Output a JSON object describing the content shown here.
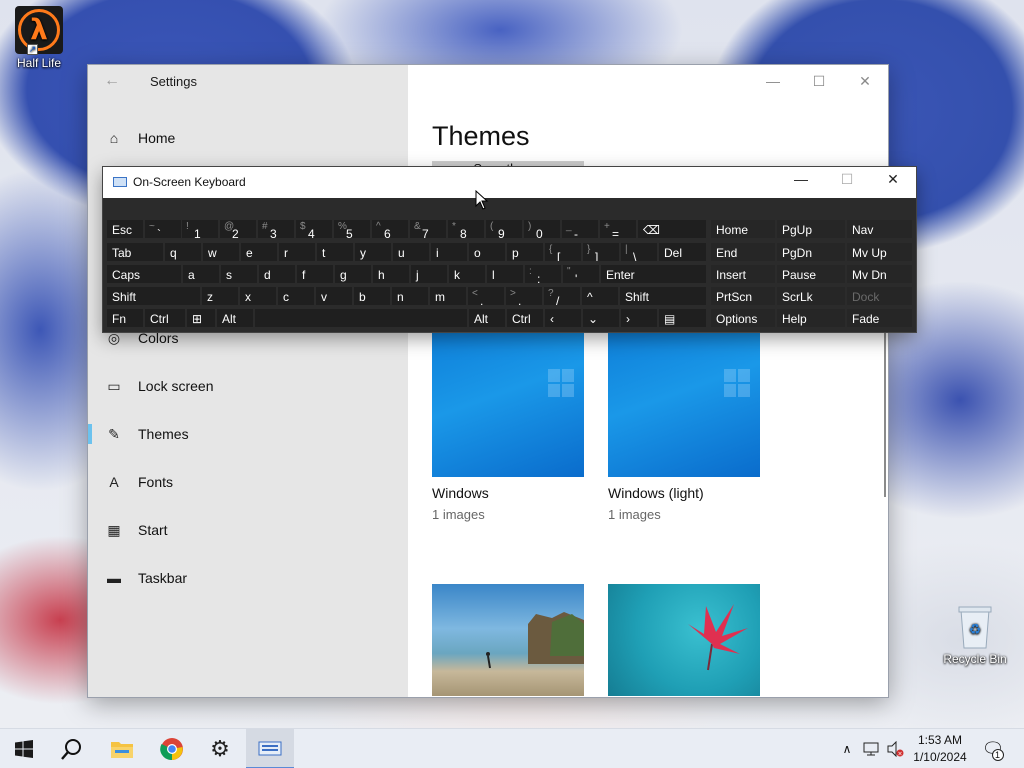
{
  "desktop": {
    "icons": [
      {
        "label": "Half Life",
        "icon": "half-life-icon"
      },
      {
        "label": "Recycle Bin",
        "icon": "recycle-bin-icon"
      }
    ]
  },
  "settings": {
    "title": "Settings",
    "page_title": "Themes",
    "save_theme_label": "Save theme",
    "nav": {
      "home": "Home",
      "colors": "Colors",
      "lock_screen": "Lock screen",
      "themes": "Themes",
      "fonts": "Fonts",
      "start": "Start",
      "taskbar": "Taskbar"
    },
    "themes": [
      {
        "name": "Windows",
        "count": "1 images"
      },
      {
        "name": "Windows (light)",
        "count": "1 images"
      }
    ]
  },
  "osk": {
    "title": "On-Screen Keyboard",
    "row1": [
      {
        "main": "Esc"
      },
      {
        "shift": "~",
        "main": "`"
      },
      {
        "shift": "!",
        "main": "1"
      },
      {
        "shift": "@",
        "main": "2"
      },
      {
        "shift": "#",
        "main": "3"
      },
      {
        "shift": "$",
        "main": "4"
      },
      {
        "shift": "%",
        "main": "5"
      },
      {
        "shift": "^",
        "main": "6"
      },
      {
        "shift": "&",
        "main": "7"
      },
      {
        "shift": "*",
        "main": "8"
      },
      {
        "shift": "(",
        "main": "9"
      },
      {
        "shift": ")",
        "main": "0"
      },
      {
        "shift": "_",
        "main": "-"
      },
      {
        "shift": "+",
        "main": "="
      },
      {
        "main": "⌫"
      }
    ],
    "row2": [
      "Tab",
      "q",
      "w",
      "e",
      "r",
      "t",
      "y",
      "u",
      "i",
      "o",
      "p",
      "[",
      "]",
      "\\",
      "Del"
    ],
    "row2_shift": {
      "lbrace": "{",
      "rbrace": "}",
      "pipe": "|"
    },
    "row3": [
      "Caps",
      "a",
      "s",
      "d",
      "f",
      "g",
      "h",
      "j",
      "k",
      "l",
      ";",
      "'",
      "Enter"
    ],
    "row3_shift": {
      "colon": ":",
      "quote": "\""
    },
    "row4": [
      "Shift",
      "z",
      "x",
      "c",
      "v",
      "b",
      "n",
      "m",
      ",",
      ".",
      "/",
      "^",
      "Shift"
    ],
    "row4_shift": {
      "lt": "<",
      "gt": ">",
      "q": "?"
    },
    "row5": [
      "Fn",
      "Ctrl",
      "Alt",
      "Alt",
      "Ctrl"
    ],
    "nav_keys": [
      [
        "Home",
        "PgUp",
        "Nav"
      ],
      [
        "End",
        "PgDn",
        "Mv Up"
      ],
      [
        "Insert",
        "Pause",
        "Mv Dn"
      ],
      [
        "PrtScn",
        "ScrLk",
        "Dock"
      ],
      [
        "Options",
        "Help",
        "Fade"
      ]
    ]
  },
  "taskbar": {
    "time": "1:53 AM",
    "date": "1/10/2024",
    "notification_count": "1"
  }
}
